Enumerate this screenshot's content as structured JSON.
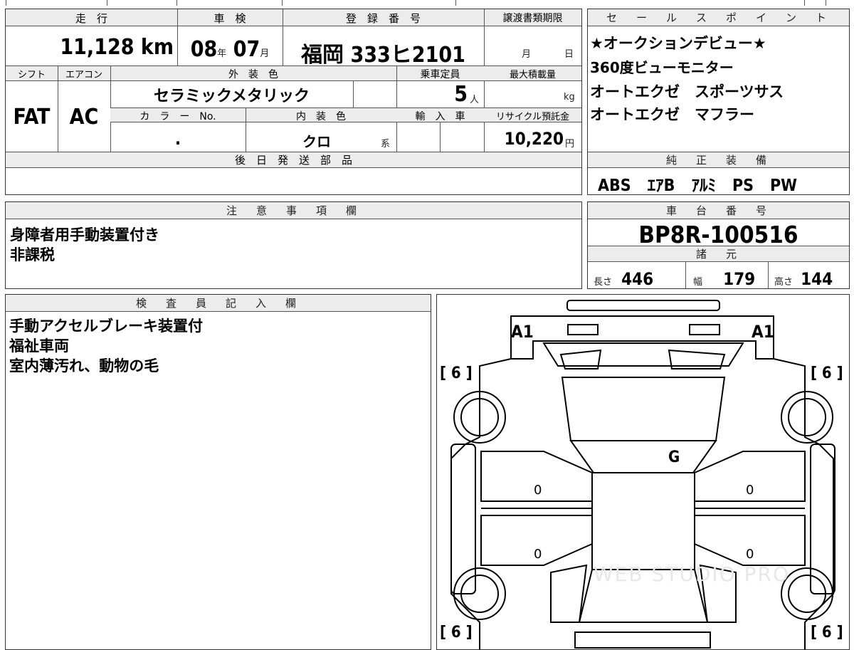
{
  "vehicle": {
    "headers": {
      "mileage": "走　行",
      "inspection": "車　検",
      "reg_no": "登　録　番　号",
      "deadline": "譲渡書類期限",
      "shift": "シフト",
      "aircon": "エアコン",
      "exterior": "外　装　色",
      "capacity": "乗車定員",
      "max_load": "最大積載量",
      "color_no": "カ　ラ　ー　No.",
      "interior": "内　装　色",
      "import": "輸　入　車",
      "recycle": "リサイクル預託金",
      "later_parts": "後　日　発　送　部　品"
    },
    "mileage_value": "11,128",
    "mileage_unit": "km",
    "inspection_year": "08",
    "year_unit": "年",
    "inspection_month": "07",
    "month_unit": "月",
    "reg_area": "福岡",
    "reg_number": "333ヒ2101",
    "deadline_month": "月",
    "deadline_day": "日",
    "shift_value": "FAT",
    "aircon_value": "AC",
    "exterior_color": "セラミックメタリック",
    "capacity_value": "5",
    "capacity_unit": "人",
    "load_unit": "kg",
    "color_no_value": ".",
    "interior_color": "クロ",
    "interior_suffix": "系",
    "recycle_value": "10,220",
    "recycle_unit": "円"
  },
  "sales": {
    "title": "セ　ー　ル　ス　ポ　イ　ン　ト",
    "points": [
      "★オークションデビュー★",
      "360度ビューモニター",
      "オートエクゼ　スポーツサス",
      "オートエクゼ　マフラー"
    ]
  },
  "equipment": {
    "title": "純　正　装　備",
    "items": "ABS　ｴｱB　ｱﾙﾐ　PS　PW"
  },
  "notes": {
    "title": "注　意　事　項　欄",
    "lines": [
      "身障者用手動装置付き",
      "非課税"
    ]
  },
  "chassis": {
    "title": "車　台　番　号",
    "number": "BP8R-100516"
  },
  "specs": {
    "title": "諸　元",
    "length_label": "長さ",
    "length": "446",
    "width_label": "幅",
    "width": "179",
    "height_label": "高さ",
    "height": "144"
  },
  "inspector": {
    "title": "検　査　員　記　入　欄",
    "lines": [
      "手動アクセルブレーキ装置付",
      "福祉車両",
      "室内薄汚れ、動物の毛"
    ]
  },
  "diagram": {
    "a1_left": "A1",
    "a1_right": "A1",
    "tire_fl": "[ 6 ]",
    "tire_fr": "[ 6 ]",
    "tire_rl": "[ 6 ]",
    "tire_rr": "[ 6 ]",
    "windshield": "G",
    "door_fl": "0",
    "door_rl": "0",
    "door_fr": "0",
    "door_rr": "0",
    "watermark": "WEB STUDIO PRO"
  }
}
